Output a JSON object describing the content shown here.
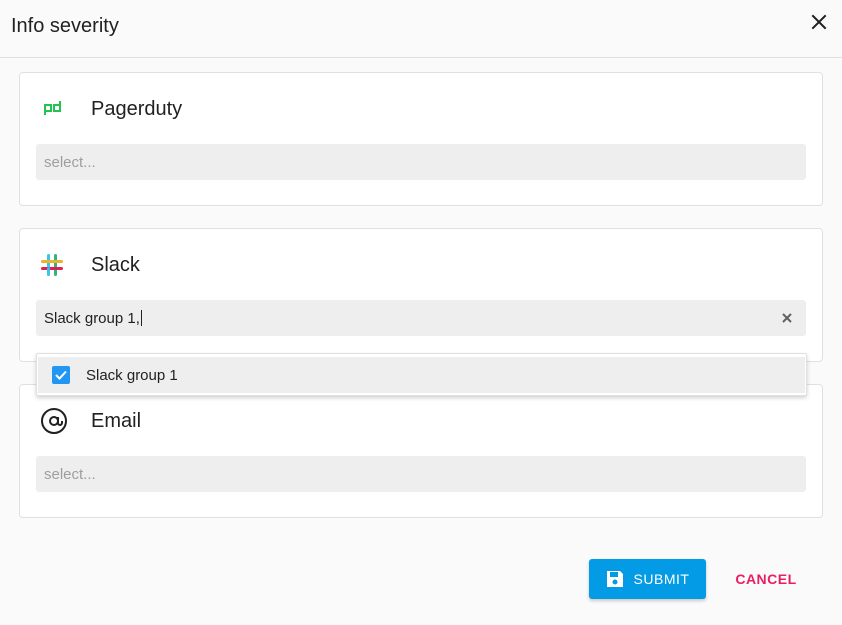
{
  "dialog": {
    "title": "Info severity",
    "close_icon": "close-icon"
  },
  "channels": [
    {
      "name": "Pagerduty",
      "icon": "pagerduty-icon",
      "field": {
        "placeholder": "select...",
        "value": ""
      }
    },
    {
      "name": "Slack",
      "icon": "slack-icon",
      "field": {
        "placeholder": "",
        "value": "Slack group 1,"
      }
    },
    {
      "name": "Email",
      "icon": "at-sign-icon",
      "field": {
        "placeholder": "select...",
        "value": ""
      }
    }
  ],
  "dropdown": {
    "options": [
      {
        "label": "Slack group 1",
        "checked": true
      }
    ]
  },
  "actions": {
    "submit_label": "SUBMIT",
    "cancel_label": "CANCEL"
  },
  "colors": {
    "primary": "#039be5",
    "checkbox": "#2196f3",
    "cancel": "#e91e63",
    "pagerduty": "#25c151"
  }
}
